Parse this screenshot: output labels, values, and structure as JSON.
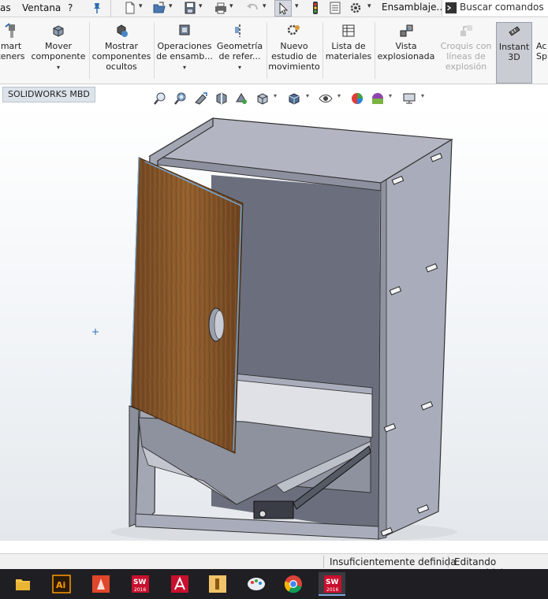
{
  "menubar": {
    "items": [
      "as",
      "Ventana",
      "?"
    ],
    "assembly_label": "Ensamblaje...",
    "search_placeholder": "Buscar comandos"
  },
  "ribbon": {
    "buttons": [
      {
        "label_1": "mart",
        "label_2": "teners"
      },
      {
        "label_1": "Mover",
        "label_2": "componente"
      },
      {
        "label_1": "Mostrar",
        "label_2": "componentes",
        "label_3": "ocultos"
      },
      {
        "label_1": "Operaciones",
        "label_2": "de ensamb..."
      },
      {
        "label_1": "Geometría",
        "label_2": "de refer..."
      },
      {
        "label_1": "Nuevo",
        "label_2": "estudio de",
        "label_3": "movimiento"
      },
      {
        "label_1": "Lista de",
        "label_2": "materiales"
      },
      {
        "label_1": "Vista",
        "label_2": "explosionada"
      },
      {
        "label_1": "Croquis con",
        "label_2": "líneas de",
        "label_3": "explosión"
      },
      {
        "label_1": "Instant",
        "label_2": "3D"
      },
      {
        "label_1": "Ac",
        "label_2": "Sp"
      }
    ]
  },
  "tabs": {
    "mbd": "SOLIDWORKS MBD"
  },
  "status": {
    "definition": "Insuficientemente definida",
    "mode": "Editando Ensamblaje"
  },
  "colors": {
    "panel": "#a9adbb",
    "panel_dark": "#6b6f7d",
    "door_wood": "#8a5a2b",
    "highlight": "#6fa8dc"
  }
}
